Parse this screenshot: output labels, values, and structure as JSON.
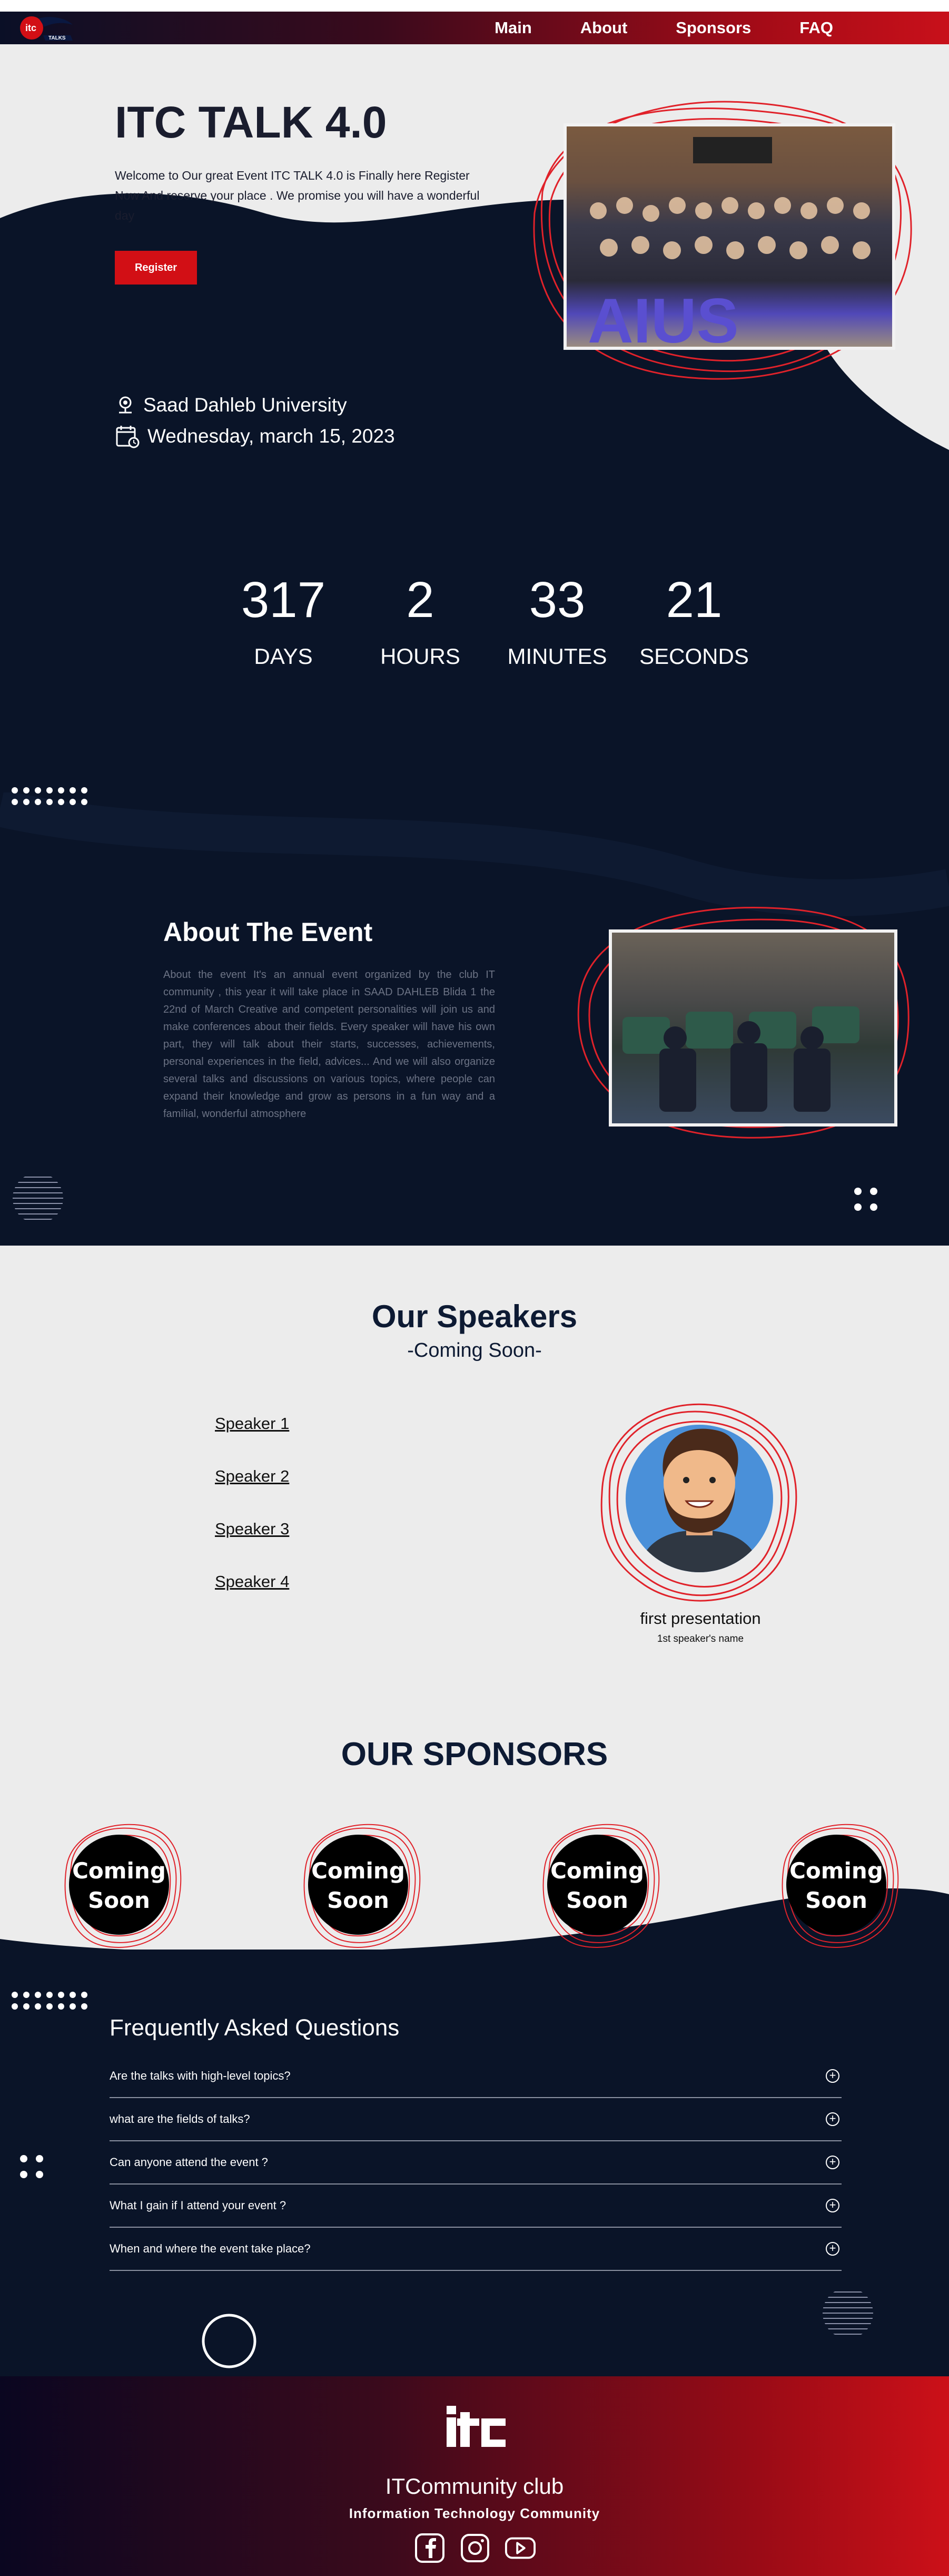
{
  "nav": {
    "links": [
      "Main",
      "About",
      "Sponsors",
      "FAQ"
    ]
  },
  "logo": {
    "text": "itc",
    "sub": "TALKS"
  },
  "hero": {
    "title": "ITC TALK 4.0",
    "description": "Welcome to Our great Event ITC TALK 4.0 is Finally here Register Now And reserve your place . We promise you will have a wonderful day",
    "register_label": "Register",
    "location": "Saad Dahleb University",
    "date": "Wednesday, march 15, 2023"
  },
  "countdown": [
    {
      "value": "317",
      "label": "DAYS"
    },
    {
      "value": "2",
      "label": "HOURS"
    },
    {
      "value": "33",
      "label": "MINUTES"
    },
    {
      "value": "21",
      "label": "SECONDS"
    }
  ],
  "about": {
    "title": "About The Event",
    "text": "About the event It's an annual event organized by the club IT community , this year it will take place in SAAD DAHLEB Blida 1 the 22nd of March Creative and competent personalities will join us and make conferences about their fields. Every speaker will have his own part, they will talk about their starts, successes, achievements, personal experiences in the field, advices... And we will also organize several talks and discussions on various topics, where people can expand their knowledge and grow as persons in a fun way and a familial, wonderful atmosphere"
  },
  "speakers": {
    "title": "Our Speakers",
    "subtitle": "-Coming Soon-",
    "items": [
      "Speaker 1",
      "Speaker 2",
      "Speaker 3",
      "Speaker 4"
    ],
    "presentation": "first presentation",
    "speaker_name": "1st speaker's name"
  },
  "sponsors": {
    "title": "OUR SPONSORS",
    "badge_line1": "Coming",
    "badge_line2": "Soon"
  },
  "faq": {
    "title": "Frequently Asked Questions",
    "items": [
      "Are the talks with high-level topics?",
      "what are the fields of talks?",
      "Can anyone attend the event ?",
      "What I gain if I attend your event ?",
      "When and where the event take place?"
    ]
  },
  "footer": {
    "club": "ITCommunity club",
    "subtitle": "Information Technology Community",
    "social": [
      "facebook-icon",
      "instagram-icon",
      "youtube-icon"
    ]
  },
  "colors": {
    "accent": "#d20f15",
    "navy": "#0a1428",
    "light": "#ececec"
  }
}
